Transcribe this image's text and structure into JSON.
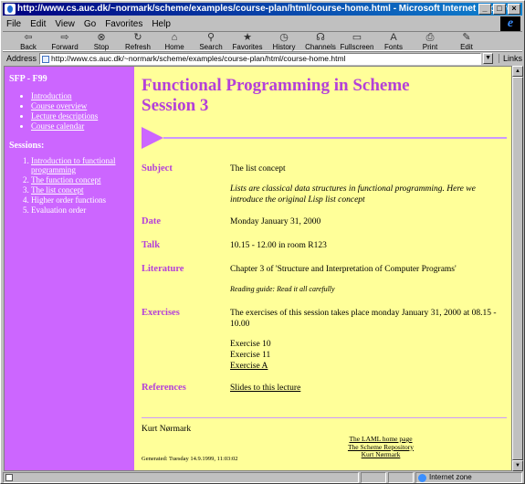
{
  "window": {
    "title": "http://www.cs.auc.dk/~normark/scheme/examples/course-plan/html/course-home.html - Microsoft Internet Explorer",
    "min_symbol": "_",
    "max_symbol": "□",
    "close_symbol": "×"
  },
  "menu": [
    "File",
    "Edit",
    "View",
    "Go",
    "Favorites",
    "Help"
  ],
  "toolbar": [
    {
      "label": "Back",
      "icon": "back-arrow-icon",
      "glyph": "⇦"
    },
    {
      "label": "Forward",
      "icon": "forward-arrow-icon",
      "glyph": "⇨"
    },
    {
      "label": "Stop",
      "icon": "stop-icon",
      "glyph": "⊗"
    },
    {
      "label": "Refresh",
      "icon": "refresh-icon",
      "glyph": "↻"
    },
    {
      "label": "Home",
      "icon": "home-icon",
      "glyph": "⌂"
    },
    {
      "label": "Search",
      "icon": "search-icon",
      "glyph": "⚲"
    },
    {
      "label": "Favorites",
      "icon": "favorites-icon",
      "glyph": "★"
    },
    {
      "label": "History",
      "icon": "history-icon",
      "glyph": "◷"
    },
    {
      "label": "Channels",
      "icon": "channels-icon",
      "glyph": "☊"
    },
    {
      "label": "Fullscreen",
      "icon": "fullscreen-icon",
      "glyph": "▭"
    },
    {
      "label": "Fonts",
      "icon": "fonts-icon",
      "glyph": "A"
    },
    {
      "label": "Print",
      "icon": "print-icon",
      "glyph": "⎙"
    },
    {
      "label": "Edit",
      "icon": "edit-icon",
      "glyph": "✎"
    }
  ],
  "address": {
    "label": "Address",
    "url": "http://www.cs.auc.dk/~normark/scheme/examples/course-plan/html/course-home.html",
    "links_label": "Links"
  },
  "sidebar": {
    "course": "SFP - F99",
    "nav": [
      "Introduction",
      "Course overview",
      "Lecture descriptions",
      "Course calendar"
    ],
    "sessions_heading": "Sessions:",
    "sessions": [
      {
        "label": "Introduction to functional programming",
        "link": true
      },
      {
        "label": "The function concept",
        "link": true
      },
      {
        "label": "The list concept",
        "link": true
      },
      {
        "label": "Higher order functions",
        "link": false
      },
      {
        "label": "Evaluation order",
        "link": false
      }
    ]
  },
  "content": {
    "title_line1": "Functional Programming in Scheme",
    "title_line2": "Session 3",
    "subject_label": "Subject",
    "subject": "The list concept",
    "subject_desc": "Lists are classical data structures in functional programming. Here we introduce the original Lisp list concept",
    "date_label": "Date",
    "date": "Monday January 31, 2000",
    "talk_label": "Talk",
    "talk": "10.15 - 12.00 in room R123",
    "literature_label": "Literature",
    "literature": "Chapter 3 of 'Structure and Interpretation of Computer Programs'",
    "reading_guide": "Reading guide: Read it all carefully",
    "exercises_label": "Exercises",
    "exercises_text": "The exercises of this session takes place monday January 31, 2000 at 08.15 - 10.00",
    "exercise_10": "Exercise 10",
    "exercise_11": "Exercise 11",
    "exercise_a": "Exercise A",
    "references_label": "References",
    "references": "Slides to this lecture"
  },
  "footer": {
    "author": "Kurt Nørmark",
    "generated": "Generated: Tuesday 14.9.1999, 11:03:02",
    "links": [
      "The LAML home page",
      "The Scheme Repository",
      "Kurt Nørmark"
    ]
  },
  "status": {
    "zone": "Internet zone"
  },
  "colors": {
    "sidebar": "#cc66ff",
    "page_bg": "#ffff99",
    "heading": "#b440d9"
  }
}
